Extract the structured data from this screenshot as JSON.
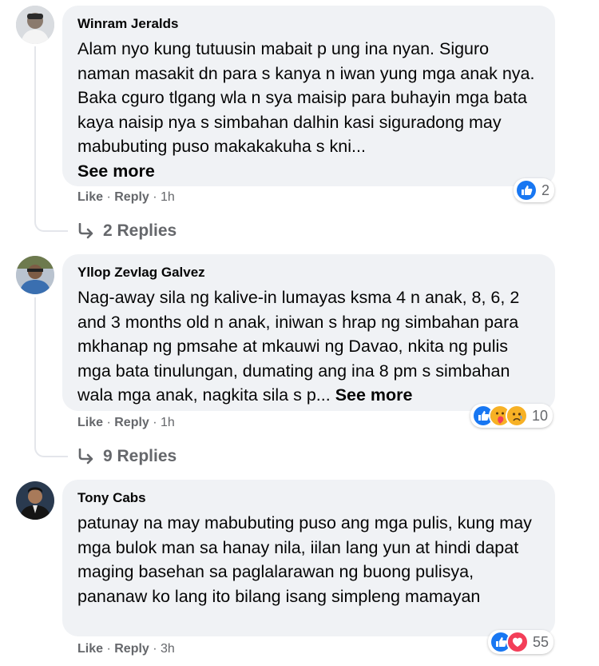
{
  "comments": [
    {
      "author": "Winram Jeralds",
      "text": "Alam nyo kung tutuusin mabait p ung ina nyan. Siguro naman masakit dn para s kanya n iwan yung mga anak nya. Baka cguro tlgang wla n sya maisip para buhayin mga bata kaya naisip nya s simbahan dalhin kasi siguradong may mabubuting puso makakakuha s kni...",
      "see_more": "See more",
      "like": "Like",
      "reply": "Reply",
      "time": "1h",
      "reaction_count": "2",
      "reactions": [
        "like-icon"
      ],
      "replies_label": "2 Replies"
    },
    {
      "author": "Yllop Zevlag Galvez",
      "text": "Nag-away sila ng kalive-in lumayas ksma 4 n anak, 8, 6, 2 and 3 months old n anak, iniwan s hrap ng simbahan para mkhanap ng pmsahe at mkauwi ng Davao, nkita ng pulis mga bata tinulungan, dumating ang ina 8 pm s simbahan wala mga anak, nagkita sila s p...",
      "see_more": "See more",
      "like": "Like",
      "reply": "Reply",
      "time": "1h",
      "reaction_count": "10",
      "reactions": [
        "like-icon",
        "care-icon",
        "sad-icon"
      ],
      "replies_label": "9 Replies"
    },
    {
      "author": "Tony Cabs",
      "text": "patunay na may mabubuting puso ang mga pulis, kung may mga bulok man sa hanay nila, iilan lang yun at hindi dapat maging basehan sa paglalarawan ng buong pulisya, pananaw ko lang ito bilang isang simpleng mamayan",
      "like": "Like",
      "reply": "Reply",
      "time": "3h",
      "reaction_count": "55",
      "reactions": [
        "like-icon",
        "love-icon"
      ]
    }
  ],
  "colors": {
    "bubble": "#f0f2f5",
    "meta_text": "#65676b",
    "like_blue": "#1877f2",
    "love_red": "#f33e58",
    "care_yellow": "#f7b125"
  }
}
